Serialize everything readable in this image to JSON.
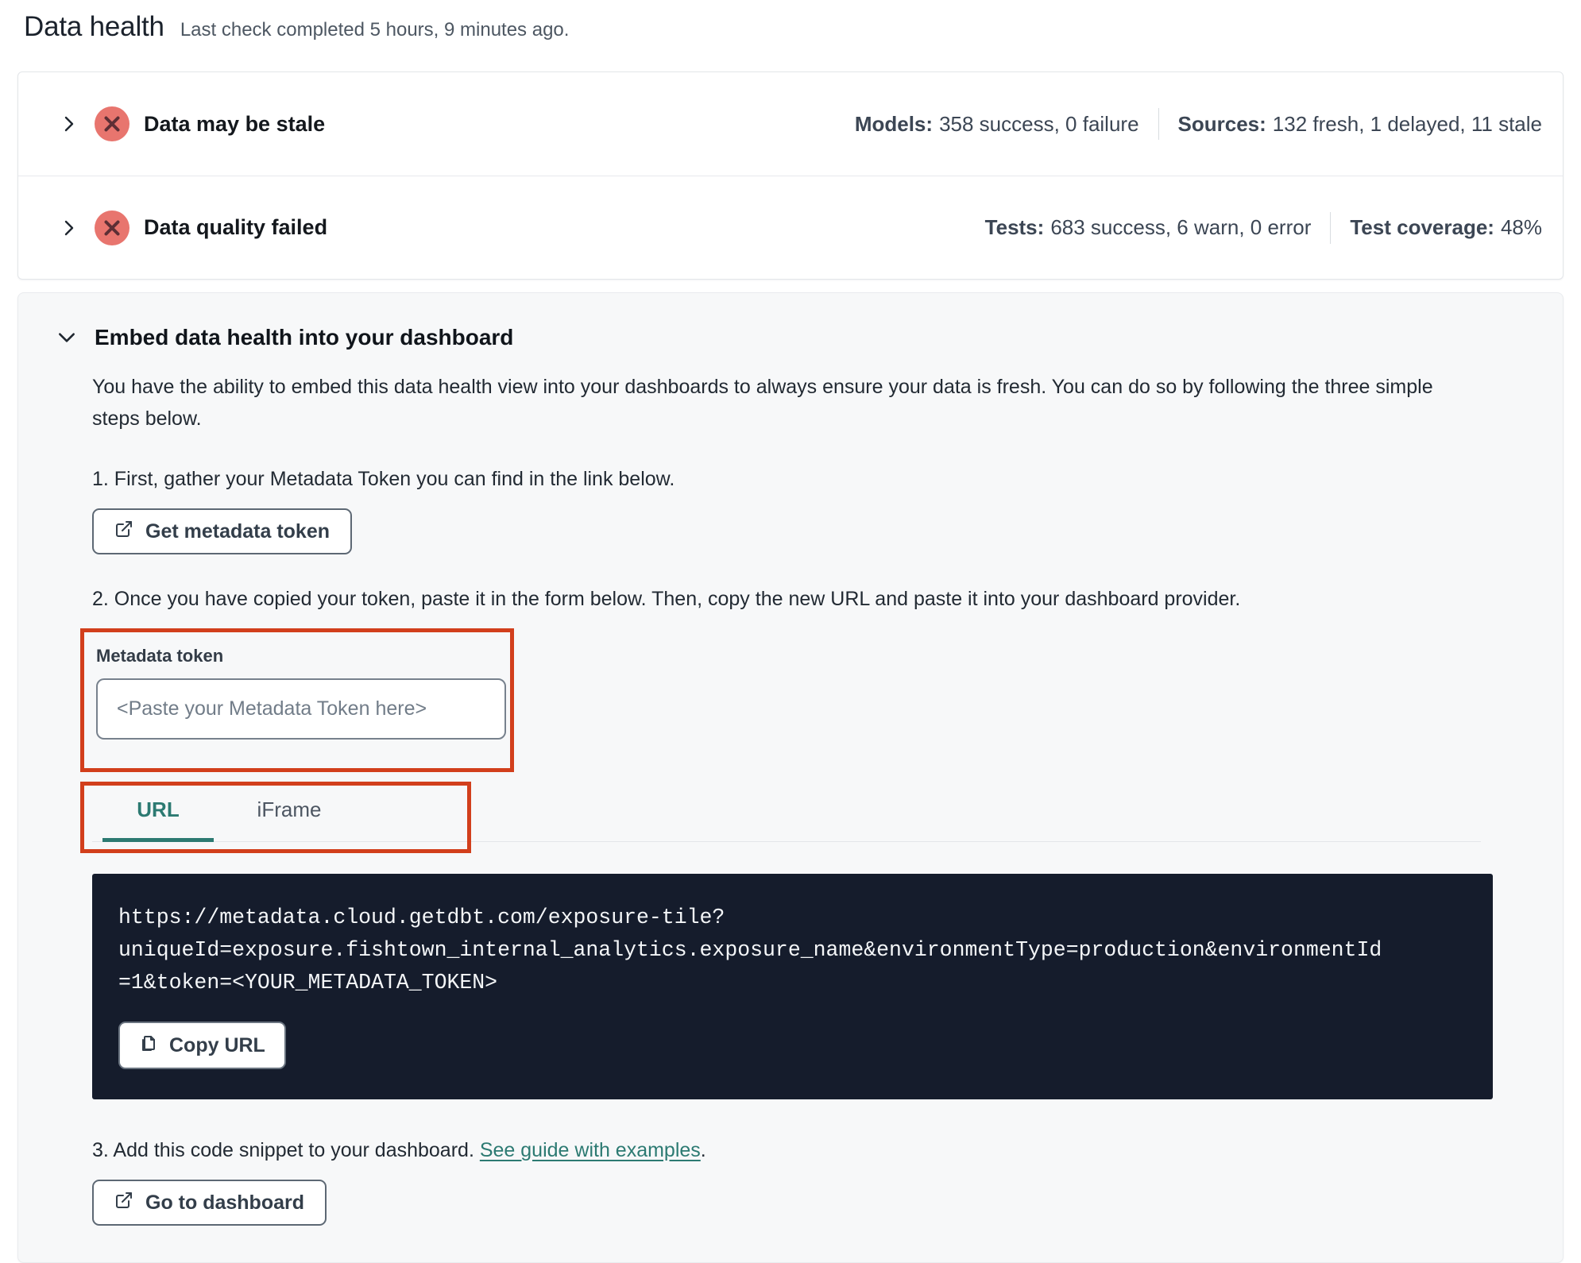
{
  "page": {
    "title": "Data health",
    "subtitle": "Last check completed 5 hours, 9 minutes ago."
  },
  "status_rows": [
    {
      "label": "Data may be stale",
      "status_icon": "error-x-circle",
      "stats": [
        {
          "name": "Models:",
          "value": "358 success, 0 failure"
        },
        {
          "name": "Sources:",
          "value": "132 fresh, 1 delayed, 11 stale"
        }
      ]
    },
    {
      "label": "Data quality failed",
      "status_icon": "error-x-circle",
      "stats": [
        {
          "name": "Tests:",
          "value": "683 success, 6 warn, 0 error"
        },
        {
          "name": "Test coverage:",
          "value": "48%"
        }
      ]
    }
  ],
  "embed": {
    "title": "Embed data health into your dashboard",
    "description": "You have the ability to embed this data health view into your dashboards to always ensure your data is fresh. You can do so by following the three simple steps below.",
    "step1": "1. First, gather your Metadata Token you can find in the link below.",
    "get_token_button": "Get metadata token",
    "step2": "2. Once you have copied your token, paste it in the form below. Then, copy the new URL and paste it into your dashboard provider.",
    "token_field": {
      "label": "Metadata token",
      "placeholder": "<Paste your Metadata Token here>"
    },
    "tabs": [
      {
        "label": "URL",
        "active": true
      },
      {
        "label": "iFrame",
        "active": false
      }
    ],
    "code_url": "https://metadata.cloud.getdbt.com/exposure-tile?\nuniqueId=exposure.fishtown_internal_analytics.exposure_name&environmentType=production&environmentId\n=1&token=<YOUR_METADATA_TOKEN>",
    "copy_button": "Copy URL",
    "step3_prefix": "3. Add this code snippet to your dashboard. ",
    "step3_link": "See guide with examples",
    "step3_suffix": ".",
    "dashboard_button": "Go to dashboard"
  },
  "colors": {
    "accent_teal": "#2c7a72",
    "error_circle": "#e8756e",
    "error_x": "#5d2f35",
    "annotation_orange": "#d23f1c",
    "code_background": "#151c2c"
  }
}
